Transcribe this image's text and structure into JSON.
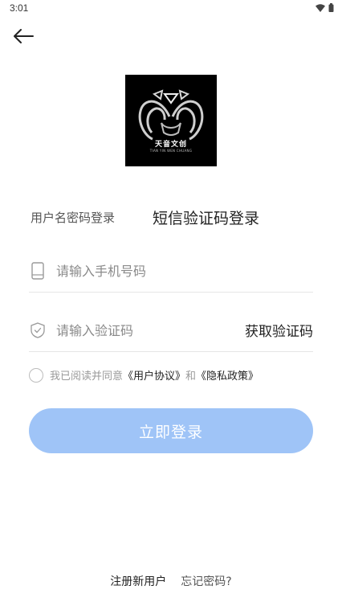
{
  "status_bar": {
    "time": "3:01",
    "icons": [
      "wifi-icon",
      "battery-icon"
    ]
  },
  "header": {
    "back_icon": "arrow-left-icon"
  },
  "logo": {
    "title": "天音文创",
    "subtitle": "TIAN YIN WEN CHUANG"
  },
  "tabs": {
    "password_login": "用户名密码登录",
    "sms_login": "短信验证码登录",
    "active": "sms_login"
  },
  "form": {
    "phone": {
      "placeholder": "请输入手机号码",
      "value": "",
      "icon": "phone-icon"
    },
    "code": {
      "placeholder": "请输入验证码",
      "value": "",
      "icon": "shield-check-icon"
    },
    "get_code_label": "获取验证码"
  },
  "agreement": {
    "prefix": "我已阅读并同意",
    "user_agreement": "《用户协议》",
    "and": "和",
    "privacy_policy": "《隐私政策》",
    "checked": false
  },
  "login_button": {
    "label": "立即登录",
    "color": "#9fc4f7"
  },
  "footer": {
    "register": "注册新用户",
    "forgot": "忘记密码?"
  }
}
